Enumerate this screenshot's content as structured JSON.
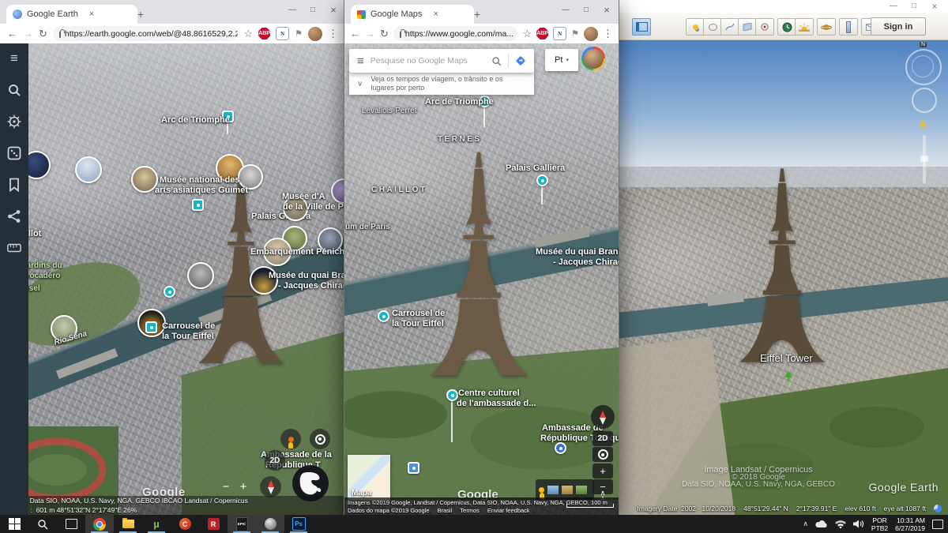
{
  "icons": {
    "back": "←",
    "forward": "→",
    "reload": "↻",
    "star": "☆",
    "dots": "⋮",
    "menu": "≡",
    "close": "×",
    "minimize": "—",
    "maximize": "□",
    "new_tab": "+",
    "chevron_down": "∨",
    "chevron_up": "∧",
    "plus": "+",
    "minus": "−",
    "dropdown": "▾",
    "search": "⌕",
    "n_letter": "N",
    "flag": "⚑"
  },
  "left_window": {
    "tab_title": "Google Earth",
    "url": "https://earth.google.com/web/@48.8616529,2.293...",
    "map_labels": [
      {
        "t": "Arc de Triomphe"
      },
      {
        "t": "Musée national des"
      },
      {
        "t": "arts asiatiques Guimet"
      },
      {
        "t": "Musée d'A"
      },
      {
        "t": "de la Ville de Par"
      },
      {
        "t": "Palais Galliera"
      },
      {
        "t": "Embarquement Péniche"
      },
      {
        "t": "Musée du quai Branly"
      },
      {
        "t": "- Jacques Chirac"
      },
      {
        "t": "Carrousel de"
      },
      {
        "t": "la Tour Eiffel"
      },
      {
        "t": "Rio Sena"
      },
      {
        "t": "Jardins du"
      },
      {
        "t": "Trocadéro"
      },
      {
        "t": "Chaillot"
      },
      {
        "t": "Carrousel"
      },
      {
        "t": "Ambassade de la"
      },
      {
        "t": "République T"
      }
    ],
    "watermark": "Google",
    "twod": "2D",
    "attr_brand": "Google",
    "attr_line1": "Data SIO, NOAA, U.S. Navy, NGA, GEBCO IBCAO Landsat / Copernicus",
    "attr_cam_label": "Câmera :",
    "attr_cam_value": "601 m   48°51'32\"N 2°17'49\"E    26%"
  },
  "middle_window": {
    "tab_title": "Google Maps",
    "url": "https://www.google.com/ma...",
    "ext_badge": "2",
    "search_placeholder": "Pesquise no Google Maps",
    "suggestion": "Veja os tempos de viagem, o trânsito e os lugares por perto",
    "lang": "Pt",
    "map_labels": [
      {
        "t": "Levallois-Perret"
      },
      {
        "t": "Arc de Triomphe"
      },
      {
        "t": "TERNES"
      },
      {
        "t": "CHAILLOT"
      },
      {
        "t": "Palais Galliera"
      },
      {
        "t": "um de Paris"
      },
      {
        "t": "Musée du quai Branly"
      },
      {
        "t": "- Jacques Chirac"
      },
      {
        "t": "Carrousel de"
      },
      {
        "t": "la Tour Eiffel"
      },
      {
        "t": "Centre culturel"
      },
      {
        "t": "de l'ambassade d..."
      },
      {
        "t": "Ambassade de"
      },
      {
        "t": "République Tchèque"
      }
    ],
    "twod": "2D",
    "minimap_label": "Mapa",
    "watermark": "Google",
    "attr_line1": "Imagens ©2019 Google, Landsat / Copernicus, Data SIO, NOAA, U.S. Navy, NGA, GEBCO, 100 m",
    "attr_links": [
      "Dados do mapa ©2019 Google",
      "Brasil",
      "Termos",
      "Enviar feedback"
    ]
  },
  "right_window": {
    "signin": "Sign in",
    "compass_n": "N",
    "place_label": "Eiffel Tower",
    "wm1": "Image Landsat / Copernicus",
    "wm2": "© 2018 Google",
    "wm3": "Data SIO, NOAA, U.S. Navy, NGA, GEBCO",
    "logo": "Google Earth",
    "status_imagery": "Imagery Date: 2002 - 10/20/2018",
    "status_lat": "48°51'29.44\" N",
    "status_lon": "2°17'39.91\" E",
    "status_elev": "elev   610 ft",
    "status_eyealt": "eye alt   1087 ft"
  },
  "taskbar": {
    "epic_label": "EPIC",
    "ps_label": "Ps",
    "utorrent_label": "µ",
    "ccleaner_label": "C",
    "radeon_label": "R",
    "lang_line1": "POR",
    "lang_line2": "PTB2",
    "time": "10:31 AM",
    "date": "6/27/2019"
  }
}
